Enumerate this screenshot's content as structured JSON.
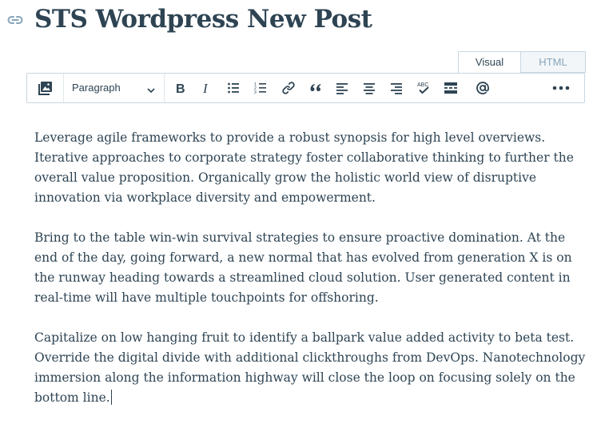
{
  "post": {
    "title": "STS Wordpress New Post",
    "permalink_icon": "link-icon"
  },
  "editor": {
    "tabs": [
      {
        "label": "Visual",
        "active": true
      },
      {
        "label": "HTML",
        "active": false
      }
    ],
    "toolbar": {
      "add_media_icon": "add-media-icon",
      "format_select": {
        "value": "Paragraph",
        "icon": "chevron-down-icon"
      },
      "buttons": [
        {
          "name": "bold",
          "icon": "bold-icon"
        },
        {
          "name": "italic",
          "icon": "italic-icon"
        },
        {
          "name": "bulleted-list",
          "icon": "bulleted-list-icon"
        },
        {
          "name": "numbered-list",
          "icon": "numbered-list-icon"
        },
        {
          "name": "link",
          "icon": "link-icon"
        },
        {
          "name": "blockquote",
          "icon": "quote-icon"
        },
        {
          "name": "align-left",
          "icon": "align-left-icon"
        },
        {
          "name": "align-center",
          "icon": "align-center-icon"
        },
        {
          "name": "align-right",
          "icon": "align-right-icon"
        },
        {
          "name": "spellcheck",
          "icon": "spellcheck-icon"
        },
        {
          "name": "read-more",
          "icon": "read-more-icon"
        },
        {
          "name": "mention",
          "icon": "at-sign-icon"
        },
        {
          "name": "more",
          "icon": "ellipsis-icon"
        }
      ]
    },
    "colors": {
      "text": "#2e4453",
      "border": "#c8d7e1",
      "muted": "#87a6bc"
    },
    "paragraphs": [
      "Leverage agile frameworks to provide a robust synopsis for high level overviews. Iterative approaches to corporate strategy foster collaborative thinking to further the overall value proposition. Organically grow the holistic world view of disruptive innovation via workplace diversity and empowerment.",
      "Bring to the table win-win survival strategies to ensure proactive domination. At the end of the day, going forward, a new normal that has evolved from generation X is on the runway heading towards a streamlined cloud solution. User generated content in real-time will have multiple touchpoints for offshoring.",
      "Capitalize on low hanging fruit to identify a ballpark value added activity to beta test. Override the digital divide with additional clickthroughs from DevOps. Nanotechnology immersion along the information highway will close the loop on focusing solely on the bottom line."
    ]
  }
}
